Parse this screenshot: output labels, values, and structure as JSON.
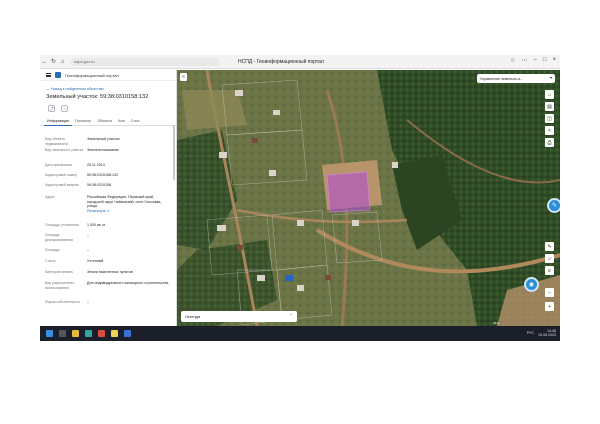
{
  "browser": {
    "url": "nspd.gov.ru",
    "window_title": "НСПД - Геоинформационный портал"
  },
  "panel": {
    "app_name": "Геоинформационный портал",
    "back_link": "← Назад к найденным объектам",
    "parcel_title": "Земельный участок: 59:38:0310158:132",
    "tabs": [
      "Информация",
      "Просмотр",
      "Объекты",
      "Кмп",
      "Слои"
    ],
    "properties": [
      {
        "key": "Вид объекта недвижимости",
        "value": "Земельный участок"
      },
      {
        "key": "Вид земельного участка",
        "value": "Землепользование"
      },
      {
        "key": "Дата присвоения",
        "value": "25.11.2014"
      },
      {
        "key": "Кадастровый номер",
        "value": "59:38:0310158:132"
      },
      {
        "key": "Кадастровый квартал",
        "value": "59:38:0310158"
      },
      {
        "key": "Адрес",
        "value": "Российская Федерация, Пермский край, городской округ Чайковский, село Ольховка, улица",
        "link": "Развернуть ∨"
      },
      {
        "key": "Площадь уточненная",
        "value": "1 000 кв. м"
      },
      {
        "key": "Площадь декларированная",
        "value": "–"
      },
      {
        "key": "Площадь",
        "value": "–"
      },
      {
        "key": "Статус",
        "value": "Учтенный"
      },
      {
        "key": "Категория земель",
        "value": "Земли населенных пунктов"
      },
      {
        "key": "Вид разрешенного использования",
        "value": "Для индивидуального жилищного строительства"
      },
      {
        "key": "Форма собственности",
        "value": "–"
      }
    ]
  },
  "map": {
    "layer_select": "Управление земельно-и...",
    "legend_label": "Легенда",
    "scale_label": "30 м"
  },
  "taskbar": {
    "tray_lang": "РУС",
    "time": "14:48",
    "date": "16.08.2023"
  },
  "colors": {
    "accent": "#2a6db5",
    "fab": "#2b8fd8",
    "parcel_fill": "#b04fd0",
    "taskbar": "#1b1f2a"
  }
}
